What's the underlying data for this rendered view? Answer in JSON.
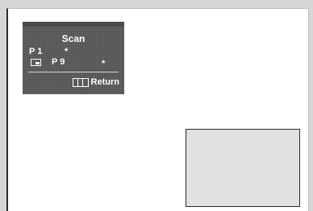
{
  "osd": {
    "title": "Scan",
    "main_channel": "P 1",
    "main_marker": "*",
    "sub_channel": "P 9",
    "sub_marker": "*",
    "return_label": "Return",
    "return_icon": "menu-icon",
    "pip_icon": "pip-icon"
  },
  "colors": {
    "osd_background": "#5b5b5b",
    "osd_text": "#ffffff",
    "screen_background": "#ffffff",
    "pip_background": "#e1e1e1"
  }
}
